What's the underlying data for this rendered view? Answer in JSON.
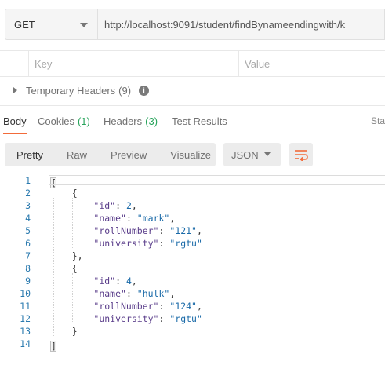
{
  "request": {
    "method": "GET",
    "url": "http://localhost:9091/student/findBynameendingwith/k"
  },
  "params_table": {
    "key_header": "Key",
    "value_header": "Value"
  },
  "temporary_headers": {
    "label": "Temporary Headers",
    "count": "(9)"
  },
  "response_tabs": [
    {
      "label": "Body",
      "count": ""
    },
    {
      "label": "Cookies",
      "count": "(1)"
    },
    {
      "label": "Headers",
      "count": "(3)"
    },
    {
      "label": "Test Results",
      "count": ""
    }
  ],
  "response_tab_cut": "Sta",
  "format_buttons": [
    "Pretty",
    "Raw",
    "Preview",
    "Visualize"
  ],
  "language_select": "JSON",
  "colors": {
    "accent": "#f26b3a",
    "count_green": "#26a35a",
    "line_numbers": "#2a7aaf"
  },
  "code_lines": [
    {
      "n": "1",
      "text": "["
    },
    {
      "n": "2",
      "text": "    {"
    },
    {
      "n": "3",
      "key": "\"id\"",
      "sep": ": ",
      "val": "2",
      "end": ","
    },
    {
      "n": "4",
      "key": "\"name\"",
      "sep": ": ",
      "val": "\"mark\"",
      "end": ","
    },
    {
      "n": "5",
      "key": "\"rollNumber\"",
      "sep": ": ",
      "val": "\"121\"",
      "end": ","
    },
    {
      "n": "6",
      "key": "\"university\"",
      "sep": ": ",
      "val": "\"rgtu\"",
      "end": ""
    },
    {
      "n": "7",
      "text": "    },"
    },
    {
      "n": "8",
      "text": "    {"
    },
    {
      "n": "9",
      "key": "\"id\"",
      "sep": ": ",
      "val": "4",
      "end": ","
    },
    {
      "n": "10",
      "key": "\"name\"",
      "sep": ": ",
      "val": "\"hulk\"",
      "end": ","
    },
    {
      "n": "11",
      "key": "\"rollNumber\"",
      "sep": ": ",
      "val": "\"124\"",
      "end": ","
    },
    {
      "n": "12",
      "key": "\"university\"",
      "sep": ": ",
      "val": "\"rgtu\"",
      "end": ""
    },
    {
      "n": "13",
      "text": "    }"
    },
    {
      "n": "14",
      "text": "]"
    }
  ]
}
